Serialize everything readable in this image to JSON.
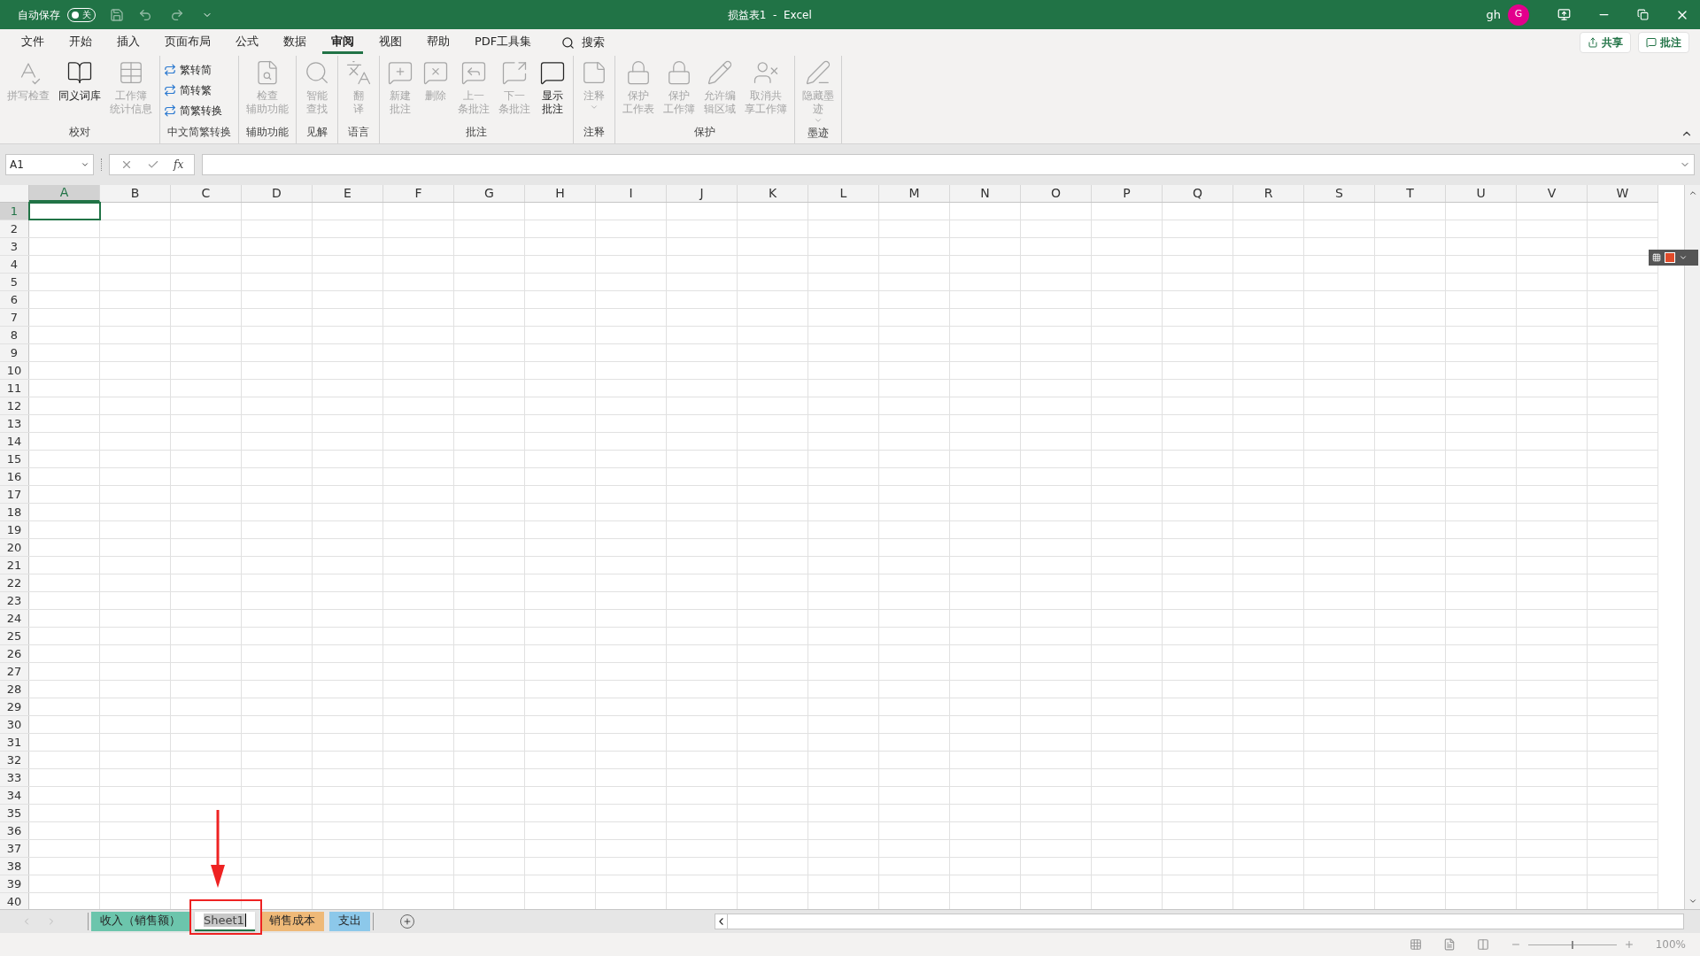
{
  "title_bar": {
    "autosave_label": "自动保存",
    "autosave": {
      "on": false,
      "label": "关"
    },
    "title": "损益表1  -  Excel",
    "user": "gh",
    "avatar": "G"
  },
  "menu_tabs": [
    {
      "label": "文件",
      "selected": false
    },
    {
      "label": "开始",
      "selected": false
    },
    {
      "label": "插入",
      "selected": false
    },
    {
      "label": "页面布局",
      "selected": false
    },
    {
      "label": "公式",
      "selected": false
    },
    {
      "label": "数据",
      "selected": false
    },
    {
      "label": "审阅",
      "selected": true
    },
    {
      "label": "视图",
      "selected": false
    },
    {
      "label": "帮助",
      "selected": false
    },
    {
      "label": "PDF工具集",
      "selected": false
    }
  ],
  "search": {
    "label": "搜索"
  },
  "share_buttons": [
    "共享",
    "批注"
  ],
  "ribbon_groups": [
    {
      "name": "校对",
      "items": [
        {
          "kind": "large",
          "lines": [
            "拼写检查"
          ],
          "disabled": true
        },
        {
          "kind": "large",
          "lines": [
            "同义词库"
          ],
          "disabled": false
        },
        {
          "kind": "large",
          "lines": [
            "工作簿",
            "统计信息"
          ],
          "disabled": true
        }
      ]
    },
    {
      "name": "中文简繁转换",
      "items": [
        {
          "kind": "small",
          "lines": [
            "繁转简"
          ],
          "disabled": false
        },
        {
          "kind": "small",
          "lines": [
            "简转繁"
          ],
          "disabled": false
        },
        {
          "kind": "small",
          "lines": [
            "简繁转换"
          ],
          "disabled": false
        }
      ]
    },
    {
      "name": "辅助功能",
      "items": [
        {
          "kind": "large",
          "lines": [
            "检查",
            "辅助功能"
          ],
          "disabled": true
        }
      ]
    },
    {
      "name": "见解",
      "items": [
        {
          "kind": "large",
          "lines": [
            "智能",
            "查找"
          ],
          "disabled": true
        }
      ]
    },
    {
      "name": "语言",
      "items": [
        {
          "kind": "large",
          "lines": [
            "翻",
            "译"
          ],
          "disabled": true
        }
      ]
    },
    {
      "name": "批注",
      "items": [
        {
          "kind": "large",
          "lines": [
            "新建",
            "批注"
          ],
          "disabled": true
        },
        {
          "kind": "large",
          "lines": [
            "删除"
          ],
          "disabled": true
        },
        {
          "kind": "large",
          "lines": [
            "上一",
            "条批注"
          ],
          "disabled": true
        },
        {
          "kind": "large",
          "lines": [
            "下一",
            "条批注"
          ],
          "disabled": true
        },
        {
          "kind": "large",
          "lines": [
            "显示",
            "批注"
          ],
          "disabled": false
        }
      ]
    },
    {
      "name": "注释",
      "items": [
        {
          "kind": "large",
          "lines": [
            "注释"
          ],
          "disabled": true,
          "dropdown": true
        }
      ]
    },
    {
      "name": "保护",
      "items": [
        {
          "kind": "large",
          "lines": [
            "保护",
            "工作表"
          ],
          "disabled": true
        },
        {
          "kind": "large",
          "lines": [
            "保护",
            "工作簿"
          ],
          "disabled": true
        },
        {
          "kind": "large",
          "lines": [
            "允许编",
            "辑区域"
          ],
          "disabled": true
        },
        {
          "kind": "large",
          "lines": [
            "取消共",
            "享工作簿"
          ],
          "disabled": true
        }
      ]
    },
    {
      "name": "墨迹",
      "items": [
        {
          "kind": "large",
          "lines": [
            "隐藏墨",
            "迹"
          ],
          "disabled": true,
          "dropdown": true
        }
      ]
    }
  ],
  "name_box": "A1",
  "formula_label": "fx",
  "columns": [
    {
      "label": "A",
      "selected": true
    },
    {
      "label": "B",
      "selected": false
    },
    {
      "label": "C",
      "selected": false
    },
    {
      "label": "D",
      "selected": false
    },
    {
      "label": "E",
      "selected": false
    },
    {
      "label": "F",
      "selected": false
    },
    {
      "label": "G",
      "selected": false
    },
    {
      "label": "H",
      "selected": false
    },
    {
      "label": "I",
      "selected": false
    },
    {
      "label": "J",
      "selected": false
    },
    {
      "label": "K",
      "selected": false
    },
    {
      "label": "L",
      "selected": false
    },
    {
      "label": "M",
      "selected": false
    },
    {
      "label": "N",
      "selected": false
    },
    {
      "label": "O",
      "selected": false
    },
    {
      "label": "P",
      "selected": false
    },
    {
      "label": "Q",
      "selected": false
    },
    {
      "label": "R",
      "selected": false
    },
    {
      "label": "S",
      "selected": false
    },
    {
      "label": "T",
      "selected": false
    },
    {
      "label": "U",
      "selected": false
    },
    {
      "label": "V",
      "selected": false
    },
    {
      "label": "W",
      "selected": false
    }
  ],
  "rows": [
    {
      "label": "1",
      "selected": true
    },
    {
      "label": "2",
      "selected": false
    },
    {
      "label": "3",
      "selected": false
    },
    {
      "label": "4",
      "selected": false
    },
    {
      "label": "5",
      "selected": false
    },
    {
      "label": "6",
      "selected": false
    },
    {
      "label": "7",
      "selected": false
    },
    {
      "label": "8",
      "selected": false
    },
    {
      "label": "9",
      "selected": false
    },
    {
      "label": "10",
      "selected": false
    },
    {
      "label": "11",
      "selected": false
    },
    {
      "label": "12",
      "selected": false
    },
    {
      "label": "13",
      "selected": false
    },
    {
      "label": "14",
      "selected": false
    },
    {
      "label": "15",
      "selected": false
    },
    {
      "label": "16",
      "selected": false
    },
    {
      "label": "17",
      "selected": false
    },
    {
      "label": "18",
      "selected": false
    },
    {
      "label": "19",
      "selected": false
    },
    {
      "label": "20",
      "selected": false
    },
    {
      "label": "21",
      "selected": false
    },
    {
      "label": "22",
      "selected": false
    },
    {
      "label": "23",
      "selected": false
    },
    {
      "label": "24",
      "selected": false
    },
    {
      "label": "25",
      "selected": false
    },
    {
      "label": "26",
      "selected": false
    },
    {
      "label": "27",
      "selected": false
    },
    {
      "label": "28",
      "selected": false
    },
    {
      "label": "29",
      "selected": false
    },
    {
      "label": "30",
      "selected": false
    },
    {
      "label": "31",
      "selected": false
    },
    {
      "label": "32",
      "selected": false
    },
    {
      "label": "33",
      "selected": false
    },
    {
      "label": "34",
      "selected": false
    },
    {
      "label": "35",
      "selected": false
    },
    {
      "label": "36",
      "selected": false
    },
    {
      "label": "37",
      "selected": false
    },
    {
      "label": "38",
      "selected": false
    },
    {
      "label": "39",
      "selected": false
    },
    {
      "label": "40",
      "selected": false
    }
  ],
  "sheet_tabs": [
    {
      "label": "收入（销售额）",
      "color": "#6cc5ac",
      "selected": false,
      "editing": false
    },
    {
      "label": "Sheet1",
      "selected": true,
      "editing": true
    },
    {
      "label": "销售成本",
      "color": "#efb978",
      "selected": false,
      "editing": false
    },
    {
      "label": "支出",
      "color": "#8cc8ea",
      "selected": false,
      "editing": false
    }
  ],
  "status_bar": {
    "zoom": "100%",
    "zoom_slider": {
      "level": 0.5
    }
  }
}
